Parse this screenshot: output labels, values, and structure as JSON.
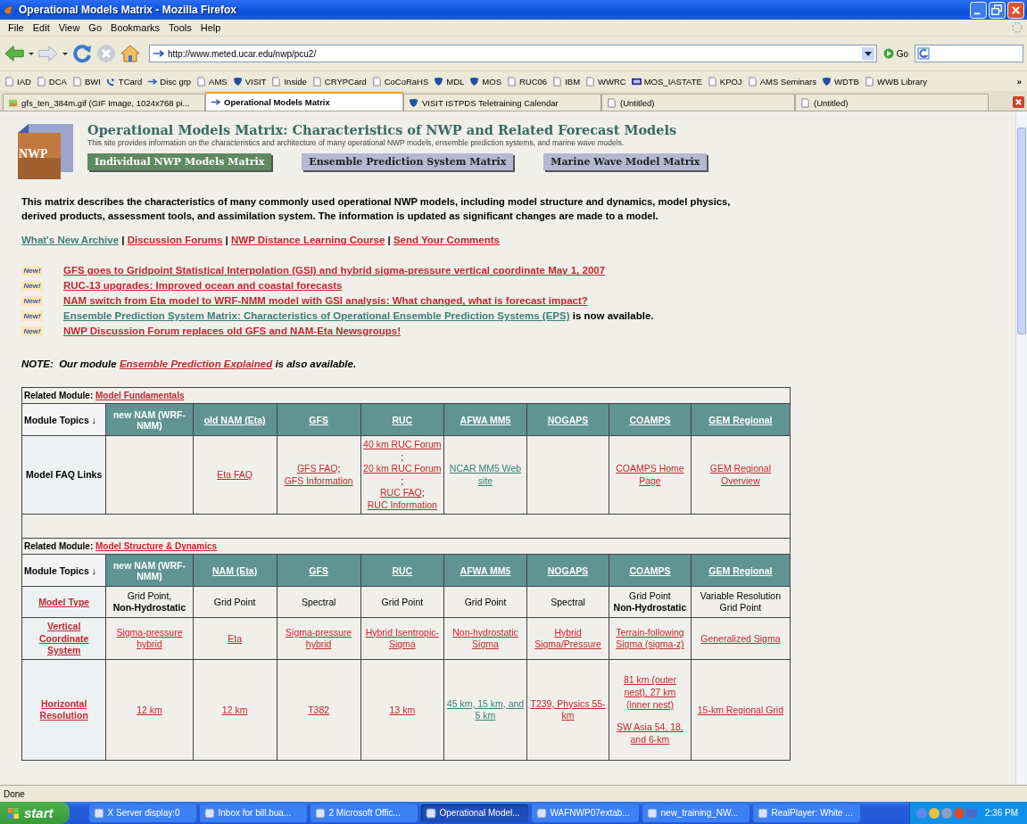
{
  "window": {
    "title": "Operational Models Matrix - Mozilla Firefox"
  },
  "menu": [
    "File",
    "Edit",
    "View",
    "Go",
    "Bookmarks",
    "Tools",
    "Help"
  ],
  "address": {
    "value": "http://www.meted.ucar.edu/nwp/pcu2/",
    "go": "Go"
  },
  "bookmarks": [
    {
      "label": "IAD",
      "kind": "page"
    },
    {
      "label": "DCA",
      "kind": "page"
    },
    {
      "label": "BWI",
      "kind": "page"
    },
    {
      "label": "TCard",
      "kind": "dish"
    },
    {
      "label": "Disc grp",
      "kind": "arrow"
    },
    {
      "label": "AMS",
      "kind": "page"
    },
    {
      "label": "VISIT",
      "kind": "shield"
    },
    {
      "label": "Inside",
      "kind": "page"
    },
    {
      "label": "CRYPCard",
      "kind": "page"
    },
    {
      "label": "CoCoRaHS",
      "kind": "page"
    },
    {
      "label": "MDL",
      "kind": "shield"
    },
    {
      "label": "MOS",
      "kind": "shield"
    },
    {
      "label": "RUC06",
      "kind": "page"
    },
    {
      "label": "IBM",
      "kind": "page"
    },
    {
      "label": "WWRC",
      "kind": "page"
    },
    {
      "label": "MOS_IASTATE",
      "kind": "badge"
    },
    {
      "label": "KPOJ",
      "kind": "page"
    },
    {
      "label": "AMS Seminars",
      "kind": "page"
    },
    {
      "label": "WDTB",
      "kind": "shield"
    },
    {
      "label": "WWB Library",
      "kind": "page"
    }
  ],
  "bookmarks_more": "»",
  "tabs": [
    {
      "label": "gfs_ten_384m.gif (GIF Image, 1024x768 pi...",
      "kind": "image",
      "selected": false
    },
    {
      "label": "Operational Models Matrix",
      "kind": "arrow",
      "selected": true
    },
    {
      "label": "VISIT ISTPDS Teletraining Calendar",
      "kind": "shield",
      "selected": false
    },
    {
      "label": "(Untitled)",
      "kind": "page",
      "selected": false
    },
    {
      "label": "(Untitled)",
      "kind": "page",
      "selected": false
    }
  ],
  "page": {
    "logo": "NWP",
    "title": "Operational Models Matrix: Characteristics of NWP and Related Forecast Models",
    "subtitle": "This site provides information on the characteristics and architecture of many operational NWP models, ensemble prediction systems, and marine wave models.",
    "nav": [
      {
        "label": "Individual NWP Models Matrix",
        "selected": true
      },
      {
        "label": "Ensemble Prediction System Matrix",
        "selected": false
      },
      {
        "label": "Marine Wave Model Matrix",
        "selected": false
      }
    ],
    "intro": "This matrix describes the characteristics of many commonly used operational NWP models, including model structure and dynamics, model physics, derived products, assessment tools, and assimilation system. The information is updated as significant changes are made to a model.",
    "links": [
      {
        "text": "What's New Archive",
        "kind": "visited"
      },
      {
        "text": " | ",
        "kind": "plain"
      },
      {
        "text": "Discussion Forums",
        "kind": "link"
      },
      {
        "text": " | ",
        "kind": "plain"
      },
      {
        "text": "NWP Distance Learning Course",
        "kind": "link"
      },
      {
        "text": " | ",
        "kind": "plain"
      },
      {
        "text": "Send Your Comments",
        "kind": "link"
      }
    ],
    "news": [
      {
        "badge": "New!",
        "parts": [
          {
            "text": "GFS goes to Gridpoint Statistical Interpolation (GSI) and hybrid sigma-pressure vertical coordinate May 1, 2007",
            "kind": "link"
          }
        ]
      },
      {
        "badge": "New!",
        "parts": [
          {
            "text": "RUC-13 upgrades: Improved ocean and coastal forecasts",
            "kind": "link"
          }
        ]
      },
      {
        "badge": "New!",
        "parts": [
          {
            "text": "NAM switch from Eta model to WRF-NMM model with GSI analysis: What changed, what is forecast impact?",
            "kind": "link"
          }
        ]
      },
      {
        "badge": "New!",
        "parts": [
          {
            "text": "Ensemble Prediction System Matrix: Characteristics of Operational Ensemble Prediction Systems (EPS)",
            "kind": "visited"
          },
          {
            "text": " is now available.",
            "kind": "plain"
          }
        ]
      },
      {
        "badge": "New!",
        "parts": [
          {
            "text": "NWP Discussion Forum replaces old GFS and NAM-Eta Newsgroups!",
            "kind": "link"
          }
        ]
      }
    ],
    "note": [
      {
        "text": "NOTE:",
        "kind": "plain"
      },
      {
        "text": "  Our module ",
        "kind": "plain"
      },
      {
        "text": "Ensemble Prediction Explained",
        "kind": "link"
      },
      {
        "text": " is also available.",
        "kind": "plain"
      }
    ],
    "sections": [
      {
        "module_label": "Related Module:",
        "module_link": "Model Fundamentals",
        "columns": [
          {
            "text": "Module Topics ↓",
            "kind": "topic"
          },
          {
            "text": "new NAM (WRF-NMM)",
            "kind": "plain"
          },
          {
            "text": "old NAM (Eta)",
            "kind": "link"
          },
          {
            "text": "GFS",
            "kind": "link"
          },
          {
            "text": "RUC",
            "kind": "link"
          },
          {
            "text": "AFWA MM5",
            "kind": "link"
          },
          {
            "text": "NOGAPS",
            "kind": "link"
          },
          {
            "text": "COAMPS",
            "kind": "link"
          },
          {
            "text": "GEM Regional",
            "kind": "link"
          }
        ],
        "rows": [
          {
            "cells": [
              {
                "lines": [
                  [
                    {
                      "text": "Model FAQ Links",
                      "kind": "bold"
                    }
                  ]
                ]
              },
              "",
              {
                "lines": [
                  [
                    {
                      "text": "Eta FAQ",
                      "kind": "link"
                    }
                  ]
                ]
              },
              {
                "lines": [
                  [
                    {
                      "text": "GFS FAQ",
                      "kind": "link"
                    },
                    {
                      "text": ";",
                      "kind": "plain"
                    }
                  ],
                  [
                    {
                      "text": "GFS Information",
                      "kind": "link"
                    }
                  ]
                ]
              },
              {
                "lines": [
                  [
                    {
                      "text": "40 km RUC Forum",
                      "kind": "link"
                    },
                    {
                      "text": ";",
                      "kind": "plain"
                    }
                  ],
                  [
                    {
                      "text": "20 km RUC Forum",
                      "kind": "link"
                    },
                    {
                      "text": ";",
                      "kind": "plain"
                    }
                  ],
                  [
                    {
                      "text": "RUC FAQ",
                      "kind": "link"
                    },
                    {
                      "text": ";",
                      "kind": "plain"
                    }
                  ],
                  [
                    {
                      "text": "RUC Information",
                      "kind": "link"
                    }
                  ]
                ]
              },
              {
                "lines": [
                  [
                    {
                      "text": "NCAR MM5 Web site",
                      "kind": "visited"
                    }
                  ]
                ]
              },
              "",
              {
                "lines": [
                  [
                    {
                      "text": "COAMPS Home Page",
                      "kind": "link"
                    }
                  ]
                ]
              },
              {
                "lines": [
                  [
                    {
                      "text": "GEM Regional Overview",
                      "kind": "link"
                    }
                  ]
                ]
              }
            ]
          }
        ]
      },
      {
        "module_label": "Related Module:",
        "module_link": "Model Structure & Dynamics",
        "columns": [
          {
            "text": "Module Topics ↓",
            "kind": "topic"
          },
          {
            "text": "new NAM (WRF-NMM)",
            "kind": "plain"
          },
          {
            "text": "NAM (Eta)",
            "kind": "link"
          },
          {
            "text": "GFS",
            "kind": "link"
          },
          {
            "text": "RUC",
            "kind": "link"
          },
          {
            "text": "AFWA MM5",
            "kind": "link"
          },
          {
            "text": "NOGAPS",
            "kind": "link"
          },
          {
            "text": "COAMPS",
            "kind": "link"
          },
          {
            "text": "GEM Regional",
            "kind": "link"
          }
        ],
        "rows": [
          {
            "cells": [
              {
                "lines": [
                  [
                    {
                      "text": "Model Type",
                      "kind": "link"
                    }
                  ]
                ]
              },
              {
                "lines": [
                  [
                    {
                      "text": "Grid Point,",
                      "kind": "plain"
                    }
                  ],
                  [
                    {
                      "text": "Non-Hydrostatic",
                      "kind": "bold"
                    }
                  ]
                ]
              },
              {
                "lines": [
                  [
                    {
                      "text": "Grid Point",
                      "kind": "plain"
                    }
                  ]
                ]
              },
              {
                "lines": [
                  [
                    {
                      "text": "Spectral",
                      "kind": "plain"
                    }
                  ]
                ]
              },
              {
                "lines": [
                  [
                    {
                      "text": "Grid Point",
                      "kind": "plain"
                    }
                  ]
                ]
              },
              {
                "lines": [
                  [
                    {
                      "text": "Grid Point",
                      "kind": "plain"
                    }
                  ]
                ]
              },
              {
                "lines": [
                  [
                    {
                      "text": "Spectral",
                      "kind": "plain"
                    }
                  ]
                ]
              },
              {
                "lines": [
                  [
                    {
                      "text": "Grid Point",
                      "kind": "plain"
                    }
                  ],
                  [
                    {
                      "text": "Non-Hydrostatic",
                      "kind": "bold"
                    }
                  ]
                ]
              },
              {
                "lines": [
                  [
                    {
                      "text": "Variable Resolution Grid Point",
                      "kind": "plain"
                    }
                  ]
                ]
              }
            ]
          },
          {
            "cells": [
              {
                "lines": [
                  [
                    {
                      "text": "Vertical Coordinate System",
                      "kind": "link"
                    }
                  ]
                ]
              },
              {
                "lines": [
                  [
                    {
                      "text": "Sigma-pressure hybrid",
                      "kind": "link"
                    }
                  ]
                ]
              },
              {
                "lines": [
                  [
                    {
                      "text": "Eta",
                      "kind": "link"
                    }
                  ]
                ]
              },
              {
                "lines": [
                  [
                    {
                      "text": "Sigma-pressure hybrid",
                      "kind": "link"
                    }
                  ]
                ]
              },
              {
                "lines": [
                  [
                    {
                      "text": "Hybrid Isentropic-Sigma",
                      "kind": "link"
                    }
                  ]
                ]
              },
              {
                "lines": [
                  [
                    {
                      "text": "Non-hydrostatic Sigma",
                      "kind": "link"
                    }
                  ]
                ]
              },
              {
                "lines": [
                  [
                    {
                      "text": "Hybrid Sigma/Pressure",
                      "kind": "link"
                    }
                  ]
                ]
              },
              {
                "lines": [
                  [
                    {
                      "text": "Terrain-following Sigma (sigma-z)",
                      "kind": "link"
                    }
                  ]
                ]
              },
              {
                "lines": [
                  [
                    {
                      "text": "Generalized Sigma",
                      "kind": "link"
                    }
                  ]
                ]
              }
            ]
          },
          {
            "cells": [
              {
                "lines": [
                  [
                    {
                      "text": "Horizontal Resolution",
                      "kind": "link"
                    }
                  ]
                ]
              },
              {
                "lines": [
                  [
                    {
                      "text": "12 km",
                      "kind": "link"
                    }
                  ]
                ]
              },
              {
                "lines": [
                  [
                    {
                      "text": "12 km",
                      "kind": "link"
                    }
                  ]
                ]
              },
              {
                "lines": [
                  [
                    {
                      "text": "T382",
                      "kind": "link"
                    }
                  ]
                ]
              },
              {
                "lines": [
                  [
                    {
                      "text": "13 km",
                      "kind": "link"
                    }
                  ]
                ]
              },
              {
                "lines": [
                  [
                    {
                      "text": "45 km, 15 km, and 5 km",
                      "kind": "visited"
                    }
                  ]
                ]
              },
              {
                "lines": [
                  [
                    {
                      "text": "T239, Physics 55-km",
                      "kind": "link"
                    }
                  ]
                ]
              },
              {
                "lines": [
                  [
                    {
                      "text": "81 km (outer nest), 27 km (inner nest)",
                      "kind": "link"
                    }
                  ]
                ],
                "after_gap": [
                  [
                    {
                      "text": "SW Asia 54, 18, and 6-km",
                      "kind": "link"
                    }
                  ]
                ]
              },
              {
                "lines": [
                  [
                    {
                      "text": "15-km Regional Grid",
                      "kind": "link"
                    }
                  ]
                ]
              }
            ]
          }
        ]
      }
    ]
  },
  "status": "Done",
  "taskbar": {
    "start": "start",
    "items": [
      {
        "label": "X Server display:0",
        "selected": false
      },
      {
        "label": "Inbox for bill.bua...",
        "selected": false
      },
      {
        "label": "2 Microsoft Offic...",
        "selected": false
      },
      {
        "label": "Operational Model...",
        "selected": true
      },
      {
        "label": "WAFNWP07extab...",
        "selected": false
      },
      {
        "label": "new_training_NW...",
        "selected": false
      },
      {
        "label": "RealPlayer: White ...",
        "selected": false
      }
    ],
    "time": "2:36 PM"
  }
}
